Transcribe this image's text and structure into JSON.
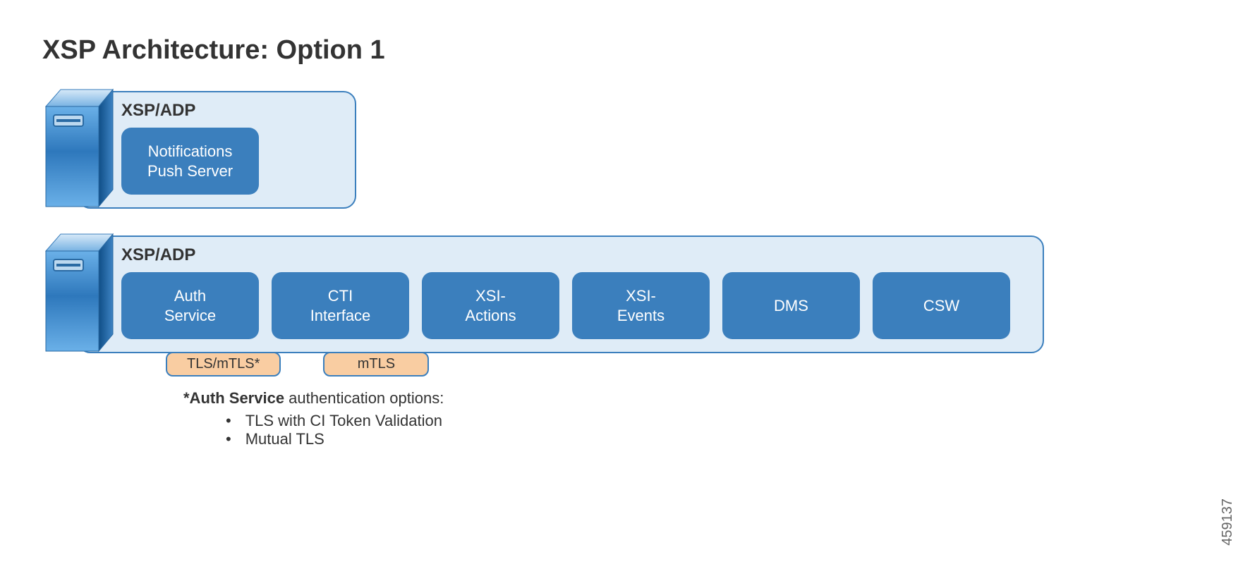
{
  "title": "XSP Architecture: Option 1",
  "group1": {
    "label": "XSP/ADP",
    "pill1_line1": "Notifications",
    "pill1_line2": "Push Server"
  },
  "group2": {
    "label": "XSP/ADP",
    "pills": {
      "auth_line1": "Auth",
      "auth_line2": "Service",
      "cti_line1": "CTI",
      "cti_line2": "Interface",
      "xsiactions_line1": "XSI-",
      "xsiactions_line2": "Actions",
      "xsievents_line1": "XSI-",
      "xsievents_line2": "Events",
      "dms": "DMS",
      "csw": "CSW"
    },
    "tags": {
      "tls_mtls": "TLS/mTLS*",
      "mtls": "mTLS"
    }
  },
  "notes": {
    "heading_bold": "*Auth Service",
    "heading_rest": " authentication options:",
    "bullet1": "TLS with CI Token Validation",
    "bullet2": "Mutual TLS"
  },
  "image_id": "459137"
}
